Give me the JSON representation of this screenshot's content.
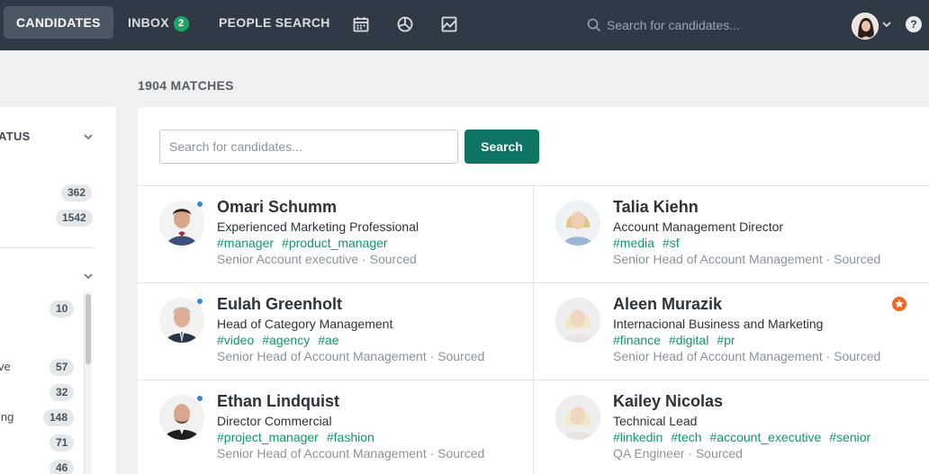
{
  "nav": {
    "tabs": [
      {
        "label": "CANDIDATES",
        "active": true
      },
      {
        "label": "INBOX",
        "badge": "2"
      },
      {
        "label": "PEOPLE SEARCH"
      }
    ],
    "icons": [
      "calendar-icon",
      "pie-chart-icon",
      "reports-icon"
    ],
    "search_placeholder": "Search for candidates...",
    "help": "?"
  },
  "matches_label": "1904 MATCHES",
  "filters": {
    "section1_title": "ATUS",
    "section1_counts": [
      "362",
      "1542"
    ],
    "section2_items": [
      {
        "label": "",
        "count": "10"
      },
      {
        "label": "ve",
        "count": "57"
      },
      {
        "label": "",
        "count": "32"
      },
      {
        "label": "ing",
        "count": "148"
      },
      {
        "label": "",
        "count": "71"
      },
      {
        "label": "",
        "count": "46"
      }
    ]
  },
  "search": {
    "placeholder": "Search for candidates...",
    "button_label": "Search"
  },
  "candidates": [
    {
      "name": "Omari Schumm",
      "title": "Experienced Marketing Professional",
      "tags": [
        "#manager",
        "#product_manager"
      ],
      "meta": "Senior Account executive · Sourced",
      "online": true
    },
    {
      "name": "Talia Kiehn",
      "title": "Account Management Director",
      "tags": [
        "#media",
        "#sf"
      ],
      "meta": "Senior Head of Account Management · Sourced",
      "online": false
    },
    {
      "name": "Eulah Greenholt",
      "title": "Head of Category Management",
      "tags": [
        "#video",
        "#agency",
        "#ae"
      ],
      "meta": "Senior Head of Account Management · Sourced",
      "online": true
    },
    {
      "name": "Aleen Murazik",
      "title": "Internacional Business and Marketing",
      "tags": [
        "#finance",
        "#digital",
        "#pr"
      ],
      "meta": "Senior Head of Account Management · Sourced",
      "online": false,
      "starred": true
    },
    {
      "name": "Ethan Lindquist",
      "title": "Director Commercial",
      "tags": [
        "#project_manager",
        "#fashion"
      ],
      "meta": "Senior Head of Account Management · Sourced",
      "online": true
    },
    {
      "name": "Kailey Nicolas",
      "title": "Technical Lead",
      "tags": [
        "#linkedin",
        "#tech",
        "#account_executive",
        "#senior"
      ],
      "meta": "QA Engineer · Sourced",
      "online": false
    }
  ]
}
